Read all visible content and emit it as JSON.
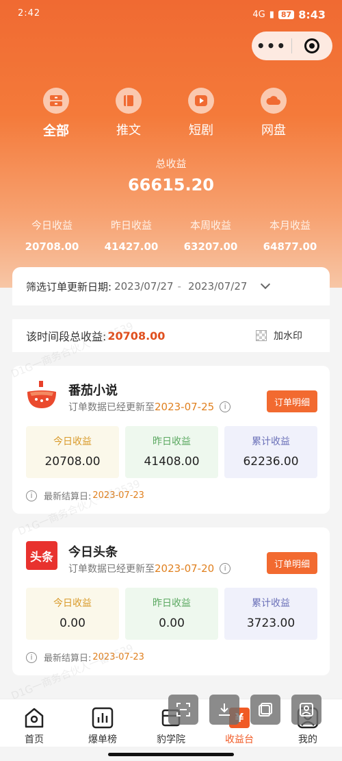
{
  "status": {
    "left": "2:42",
    "time": "8:43",
    "battery": "87",
    "network": "4G"
  },
  "capsule": {
    "dots": "•••"
  },
  "categories": [
    {
      "label": "全部"
    },
    {
      "label": "推文"
    },
    {
      "label": "短剧"
    },
    {
      "label": "网盘"
    }
  ],
  "summary": {
    "total_label": "总收益",
    "total_value": "66615.20"
  },
  "periods": [
    {
      "label": "今日收益",
      "value": "20708.00"
    },
    {
      "label": "昨日收益",
      "value": "41427.00"
    },
    {
      "label": "本周收益",
      "value": "63207.00"
    },
    {
      "label": "本月收益",
      "value": "64877.00"
    }
  ],
  "filter": {
    "label": "筛选订单更新日期:",
    "start": "2023/07/27",
    "dash": "-",
    "end": "2023/07/27"
  },
  "range": {
    "label": "该时间段总收益:",
    "amount": "20708.00",
    "watermark_label": "加水印"
  },
  "platforms": [
    {
      "name": "番茄小说",
      "sub_prefix": "订单数据已经更新至",
      "sub_date": "2023-07-25",
      "detail_label": "订单明细",
      "today_label": "今日收益",
      "today_value": "20708.00",
      "yesterday_label": "昨日收益",
      "yesterday_value": "41408.00",
      "cumulative_label": "累计收益",
      "cumulative_value": "62236.00",
      "settle_label": "最新结算日:",
      "settle_date": "2023-07-23"
    },
    {
      "name": "今日头条",
      "logo_text": "头条",
      "sub_prefix": "订单数据已经更新至",
      "sub_date": "2023-07-20",
      "detail_label": "订单明细",
      "today_label": "今日收益",
      "today_value": "0.00",
      "yesterday_label": "昨日收益",
      "yesterday_value": "0.00",
      "cumulative_label": "累计收益",
      "cumulative_value": "3723.00",
      "settle_label": "最新结算日:",
      "settle_date": "2023-07-23"
    }
  ],
  "nav": [
    {
      "label": "首页"
    },
    {
      "label": "爆单榜"
    },
    {
      "label": "豹学院"
    },
    {
      "label": "收益台"
    },
    {
      "label": "我的"
    }
  ],
  "watermark": "D1G一商务合伙人一番2539",
  "colors": {
    "accent": "#f26a30",
    "amount": "#e0501f",
    "date": "#e0801f"
  }
}
